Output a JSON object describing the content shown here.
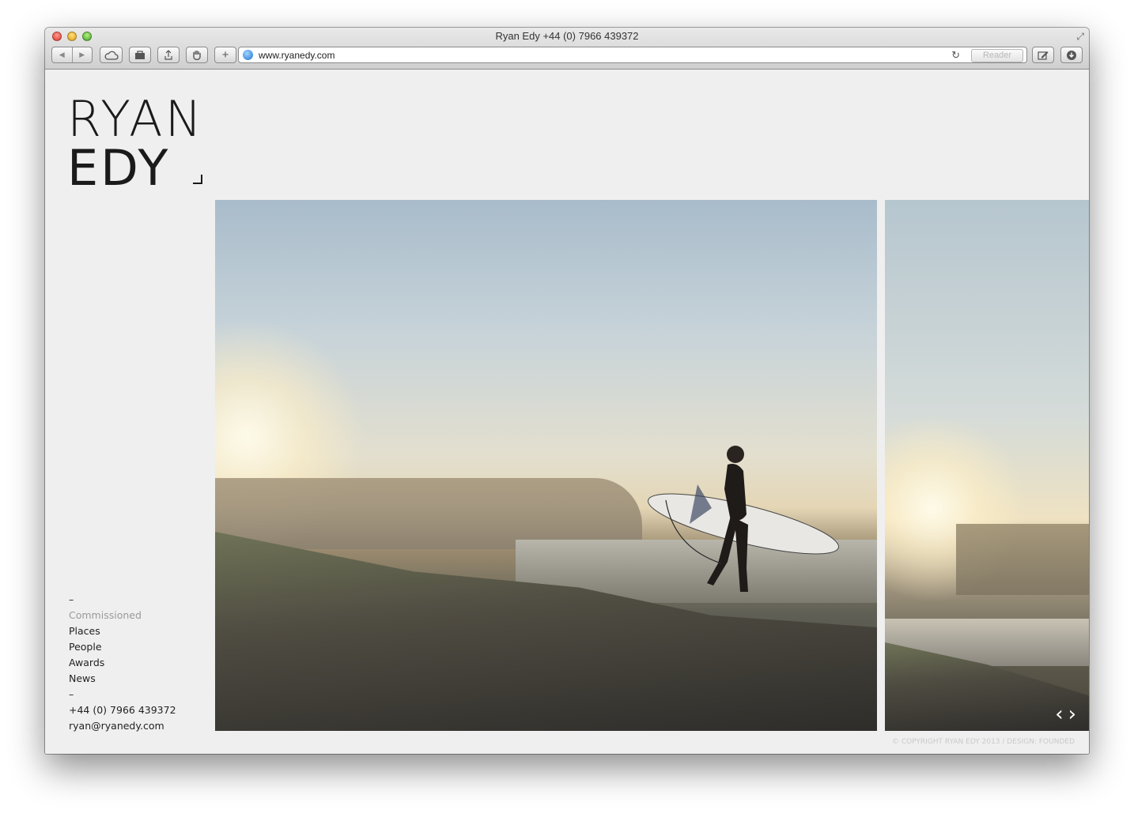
{
  "window": {
    "title": "Ryan Edy +44 (0) 7966 439372",
    "url": "www.ryanedy.com",
    "reader_label": "Reader"
  },
  "logo": {
    "line1": "RYAN",
    "line2": "EDY"
  },
  "nav": {
    "dash1": "–",
    "items": [
      "Commissioned",
      "Places",
      "People",
      "Awards",
      "News"
    ],
    "dash2": "–",
    "phone": "+44 (0) 7966 439372",
    "email": "ryan@ryanedy.com"
  },
  "gallery": {
    "prev_arrow": "‹",
    "next_arrow": "›"
  },
  "footer": {
    "copyright": "© COPYRIGHT RYAN EDY 2013 / DESIGN: FOUNDED"
  },
  "icons": {
    "back": "back-arrow-icon",
    "forward": "forward-arrow-icon",
    "icloud": "cloud-icon",
    "reading_list": "bag-icon",
    "share": "share-icon",
    "hand": "hand-icon",
    "new_tab": "plus-icon",
    "reload": "reload-icon",
    "edit": "pencil-icon",
    "download": "download-icon"
  },
  "colors": {
    "page_bg": "#efefef",
    "muted_nav": "#9a9a9a",
    "text": "#222222"
  }
}
